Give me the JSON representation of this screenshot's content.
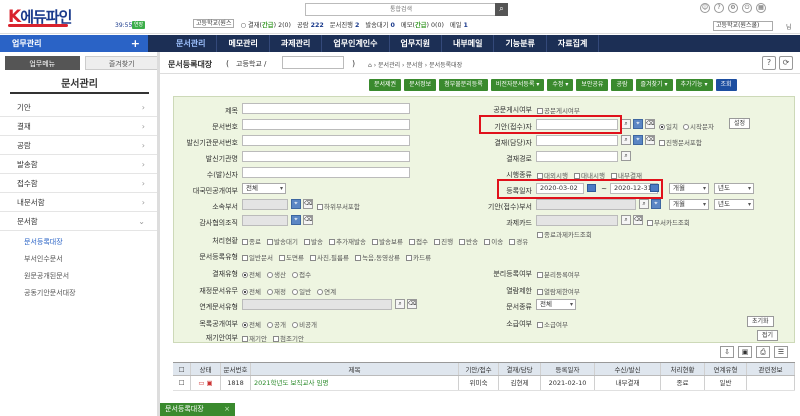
{
  "header": {
    "logo_text": "에듀파인",
    "logo_k": "K",
    "session_timer": "39:55",
    "session_btn": "연장",
    "search_placeholder": "통합검색",
    "search_btn": "⌕",
    "org_select": "고등학교(원스",
    "stats": [
      {
        "label": "결재(",
        "value": "간급",
        "tail": ") 2(0)"
      },
      {
        "label": "공람 ",
        "value": "222",
        "tail": ""
      },
      {
        "label": "문서진행 ",
        "value": "2",
        "tail": ""
      },
      {
        "label": "발송대기 ",
        "value": "0",
        "tail": ""
      },
      {
        "label": "메모(",
        "value": "간급",
        "tail": ") 0(0)"
      },
      {
        "label": "메일 ",
        "value": "1",
        "tail": ""
      }
    ],
    "user_select": "고등학교(원스쿨)",
    "user_suffix": "님",
    "icons": [
      "user-circle-icon",
      "help-icon",
      "settings-icon",
      "logout-icon"
    ]
  },
  "nav": {
    "home_label": "업무관리",
    "home_plus": "+",
    "items": [
      "문서관리",
      "메모관리",
      "과제관리",
      "업무인계인수",
      "업무지원",
      "내부메일",
      "기능분류",
      "자료집계"
    ],
    "active_index": 0
  },
  "sidebar": {
    "tabs": [
      "업무메뉴",
      "즐겨찾기"
    ],
    "active_tab": 0,
    "title": "문서관리",
    "items": [
      {
        "label": "기안",
        "chev": "›"
      },
      {
        "label": "결재",
        "chev": "›"
      },
      {
        "label": "공람",
        "chev": "›"
      },
      {
        "label": "발송함",
        "chev": "›"
      },
      {
        "label": "접수함",
        "chev": "›"
      },
      {
        "label": "내문서함",
        "chev": "›"
      },
      {
        "label": "문서함",
        "chev": "⌄"
      }
    ],
    "sub_items": [
      "문서등록대장",
      "부서인수문서",
      "원문공개된문서",
      "공동기안문서대장"
    ],
    "active_sub": 0
  },
  "page": {
    "title": "문서등록대장",
    "paren_open": "(",
    "school": "고등학교 /",
    "paren_close": ")",
    "breadcrumb": "⌂  ›  문서관리 › 문서함 › 문서등록대장"
  },
  "actions": [
    {
      "label": "문서제권",
      "color": "green"
    },
    {
      "label": "문서정보",
      "color": "green"
    },
    {
      "label": "첨부물분리등록",
      "color": "green"
    },
    {
      "label": "비전자문서등록 ▾",
      "color": "green"
    },
    {
      "label": "수정 ▾",
      "color": "green"
    },
    {
      "label": "보안공유",
      "color": "green"
    },
    {
      "label": "공람",
      "color": "green"
    },
    {
      "label": "즐겨찾기 ▾",
      "color": "green"
    },
    {
      "label": "추가기능 ▾",
      "color": "green"
    },
    {
      "label": "조회",
      "color": "blue"
    }
  ],
  "form": {
    "title_label": "제목",
    "doc_no_label": "문서번호",
    "sender_no_label": "발신기관문서번호",
    "sender_label": "발신기관명",
    "receiver_label": "수(발)신자",
    "external_label": "대국민공개여부",
    "external_value": "전체",
    "dept_label": "소속부서",
    "dept_check": "하위부서포함",
    "audit_label": "감사협의조직",
    "process_label": "처리현황",
    "process_options": [
      "종료",
      "발송대기",
      "발송",
      "추가재발송",
      "발송보류",
      "접수",
      "진행",
      "반송",
      "이송",
      "경유"
    ],
    "reg_type_label": "문서등록유형",
    "reg_type_options": [
      "일반문서",
      "도면류",
      "사진,필름류",
      "녹음,동영상류",
      "카드류"
    ],
    "sign_type_label": "결재유형",
    "sign_type_options": [
      "전체",
      "생산",
      "접수"
    ],
    "reuse_label": "재정문서유무",
    "reuse_options": [
      "전체",
      "재정",
      "일반",
      "연계"
    ],
    "linked_label": "연계문서유형",
    "public_label": "목록공개여부",
    "public_options": [
      "전체",
      "공개",
      "비공개"
    ],
    "redraft_label": "재기안여부",
    "redraft_options": [
      "재기안",
      "첨조기안"
    ],
    "pubreq_label": "공문게시여부",
    "pubreq_check": "공문게시여부",
    "drafter_label": "기안(접수)자",
    "drafter_options": [
      "일치",
      "시작문자"
    ],
    "set_btn": "설정",
    "signer_label": "결재(담당)자",
    "signer_check": "진행문서포함",
    "route_label": "결재경로",
    "special_label": "시행종류",
    "special_options": [
      "대외시행",
      "대내시행",
      "내부결재"
    ],
    "reg_date_label": "등록일자",
    "date_from": "2020-03-02",
    "date_sep": "~",
    "date_to": "2020-12-31",
    "period_select": "개월",
    "year_select": "년도",
    "dept2_label": "기안(접수)부서",
    "task_card_label": "과제카드",
    "task_card_check": "종료과제카드조회",
    "dept_card_check": "부서카드조회",
    "split_label": "분리등록여부",
    "split_check": "분리등록여부",
    "view_limit_label": "열람제한",
    "view_limit_check": "열람제한여부",
    "doc_kind_label": "문서종류",
    "doc_kind_value": "전체",
    "audit2_label": "소급여부",
    "audit2_check": "소급여부",
    "reset_btn": "초기화",
    "close_btn": "접기"
  },
  "grid": {
    "headers": [
      "",
      "상태",
      "문서번호",
      "제목",
      "기안/접수",
      "결재/담당",
      "등록일자",
      "수신/발신",
      "처리현황",
      "연계유형",
      "관련정보"
    ],
    "rows": [
      {
        "no": "1818",
        "title": "2021학년도 보직교사 임명",
        "drafter": "위미숙",
        "signer": "김현제",
        "date": "2021-02-10",
        "recv": "내부결재",
        "status": "종료",
        "link": "일반",
        "info": ""
      }
    ]
  },
  "bottom_tab": {
    "label": "문서등록대장",
    "close": "×"
  }
}
